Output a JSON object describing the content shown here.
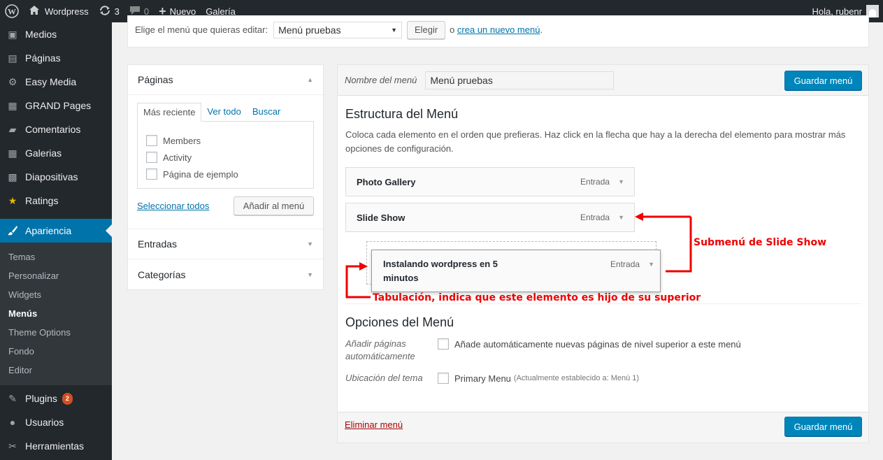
{
  "adminbar": {
    "site_name": "Wordpress",
    "updates_count": "3",
    "comments_count": "0",
    "new_label": "Nuevo",
    "gallery_label": "Galería",
    "greeting": "Hola, rubenr"
  },
  "sidebar": {
    "items_top": [
      {
        "label": "Medios",
        "icon": "media-icon"
      },
      {
        "label": "Páginas",
        "icon": "pages-icon"
      },
      {
        "label": "Easy Media",
        "icon": "easy-media-icon"
      },
      {
        "label": "GRAND Pages",
        "icon": "grand-pages-icon"
      },
      {
        "label": "Comentarios",
        "icon": "comments-icon"
      },
      {
        "label": "Galerias",
        "icon": "grid-icon"
      },
      {
        "label": "Diapositivas",
        "icon": "slides-icon"
      },
      {
        "label": "Ratings",
        "icon": "star-icon"
      }
    ],
    "current": {
      "label": "Apariencia",
      "icon": "brush-icon"
    },
    "submenu": [
      "Temas",
      "Personalizar",
      "Widgets",
      "Menús",
      "Theme Options",
      "Fondo",
      "Editor"
    ],
    "items_bottom": [
      {
        "label": "Plugins",
        "icon": "plugin-icon",
        "badge": "2"
      },
      {
        "label": "Usuarios",
        "icon": "users-icon"
      },
      {
        "label": "Herramientas",
        "icon": "tools-icon"
      }
    ]
  },
  "manage": {
    "label": "Elige el menú que quieras editar:",
    "selected_menu": "Menú pruebas",
    "select_button": "Elegir",
    "or_text": "o",
    "create_link": "crea un nuevo menú",
    "create_suffix": "."
  },
  "accordion": {
    "pages_title": "Páginas",
    "tabs": [
      "Más reciente",
      "Ver todo",
      "Buscar"
    ],
    "pages": [
      "Members",
      "Activity",
      "Página de ejemplo"
    ],
    "select_all": "Seleccionar todos",
    "add_button": "Añadir al menú",
    "entries_title": "Entradas",
    "categories_title": "Categorías"
  },
  "editor": {
    "name_label": "Nombre del menú",
    "name_value": "Menú pruebas",
    "save_button": "Guardar menú",
    "structure_title": "Estructura del Menú",
    "structure_desc": "Coloca cada elemento en el orden que prefieras. Haz click en la flecha que hay a la derecha del elemento para mostrar más opciones de configuración.",
    "items": [
      {
        "title": "Photo Gallery",
        "type": "Entrada"
      },
      {
        "title": "Slide Show",
        "type": "Entrada"
      }
    ],
    "child_item": {
      "title": "Instalando wordpress en 5 minutos",
      "type": "Entrada"
    },
    "options_title": "Opciones del Menú",
    "auto_add_label": "Añadir páginas automáticamente",
    "auto_add_text": "Añade automáticamente nuevas páginas de nivel superior a este menú",
    "location_label": "Ubicación del tema",
    "location_text": "Primary Menu",
    "location_note": "(Actualmente establecido a: Menú 1)",
    "delete_link": "Eliminar menú"
  },
  "annotations": {
    "submenu_note": "Submenú de Slide Show",
    "indent_note": "Tabulación, indica que este elemento es hijo de su superior",
    "color": "#e00000"
  }
}
